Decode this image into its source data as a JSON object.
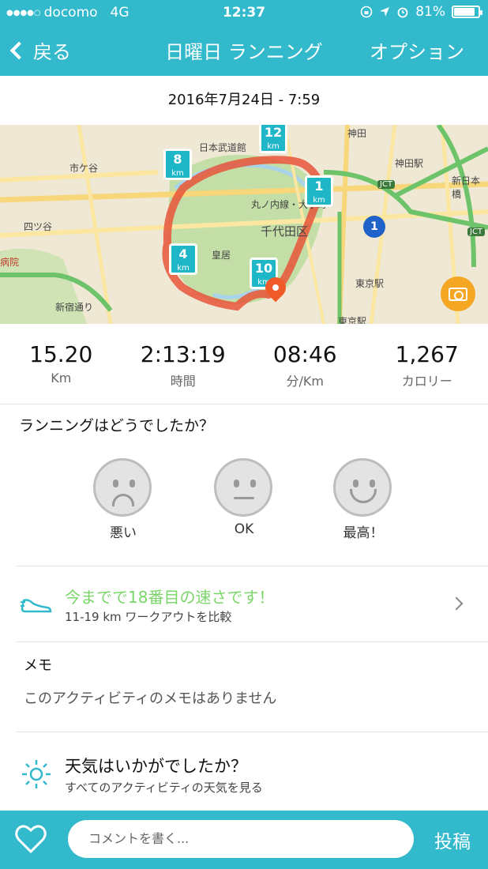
{
  "status": {
    "carrier": "docomo",
    "network": "4G",
    "time": "12:37",
    "battery": "81%"
  },
  "nav": {
    "back_label": "戻る",
    "title": "日曜日 ランニング",
    "options_label": "オプション"
  },
  "date": "2016年7月24日 - 7:59",
  "map": {
    "labels": [
      "日本武道館",
      "市ケ谷",
      "四ツ谷",
      "神田",
      "神田駅",
      "新日本橋",
      "丸ノ内線・大手町",
      "千代田区",
      "皇居",
      "東京駅",
      "東京駅",
      "病院",
      "新宿通り",
      "JCT",
      "JCT",
      "1"
    ],
    "markers": [
      {
        "num": "8",
        "unit": "km"
      },
      {
        "num": "12",
        "unit": "km"
      },
      {
        "num": "1",
        "unit": "km"
      },
      {
        "num": "4",
        "unit": "km"
      },
      {
        "num": "10",
        "unit": "km"
      }
    ],
    "route_color": "#e8553a",
    "accent": "#32b9cc"
  },
  "stats": [
    {
      "value": "15.20",
      "unit": "Km"
    },
    {
      "value": "2:13:19",
      "unit": "時間"
    },
    {
      "value": "08:46",
      "unit": "分/Km"
    },
    {
      "value": "1,267",
      "unit": "カロリー"
    }
  ],
  "feedback": {
    "question": "ランニングはどうでしたか？",
    "options": [
      "悪い",
      "OK",
      "最高！"
    ]
  },
  "compare": {
    "title": "今までで18番目の速さです！",
    "subtitle": "11-19 km ワークアウトを比較",
    "title_color": "#7bd66a"
  },
  "memo": {
    "title": "メモ",
    "empty_text": "このアクティビティのメモはありません"
  },
  "weather": {
    "title": "天気はいかがでしたか？",
    "subtitle": "すべてのアクティビティの天気を見る"
  },
  "bottom": {
    "comment_placeholder": "コメントを書く...",
    "post_label": "投稿"
  }
}
